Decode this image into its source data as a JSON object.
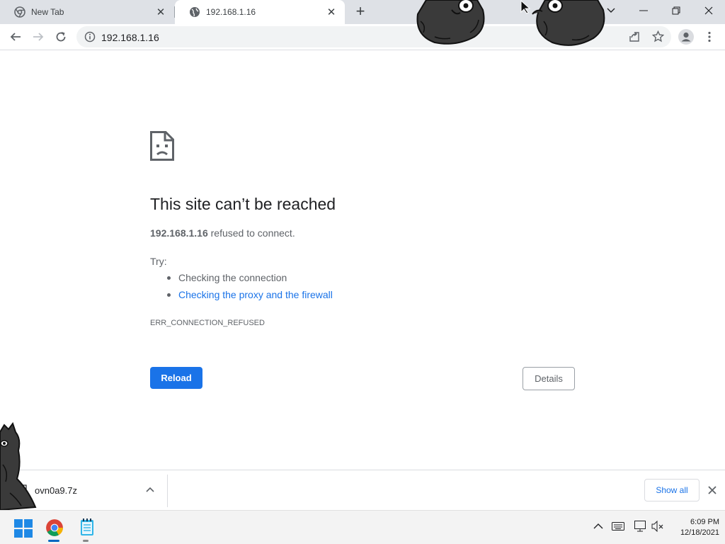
{
  "browser": {
    "tabs": [
      {
        "title": "New Tab",
        "active": false
      },
      {
        "title": "192.168.1.16",
        "active": true
      }
    ],
    "address": "192.168.1.16",
    "icons": [
      "back-icon",
      "forward-icon",
      "reload-icon",
      "info-icon",
      "share-icon",
      "star-icon",
      "profile-icon",
      "menu-icon",
      "tab-search-icon",
      "minimize-icon",
      "restore-icon",
      "close-icon"
    ]
  },
  "error_page": {
    "title": "This site can’t be reached",
    "host": "192.168.1.16",
    "desc_rest": " refused to connect.",
    "try_label": "Try:",
    "suggestions": [
      "Checking the connection",
      "Checking the proxy and the firewall"
    ],
    "error_code": "ERR_CONNECTION_REFUSED",
    "reload_label": "Reload",
    "details_label": "Details"
  },
  "downloads": {
    "file_name": "ovn0a9.7z",
    "show_all_label": "Show all"
  },
  "taskbar": {
    "time": "6:09 PM",
    "date": "12/18/2021",
    "apps": [
      "windows-start-icon",
      "chrome-icon",
      "notepad-icon"
    ]
  },
  "colors": {
    "accent": "#1a73e8",
    "tabstrip": "#dee1e6",
    "omnibox": "#f1f3f4",
    "text_secondary": "#5f6368"
  }
}
